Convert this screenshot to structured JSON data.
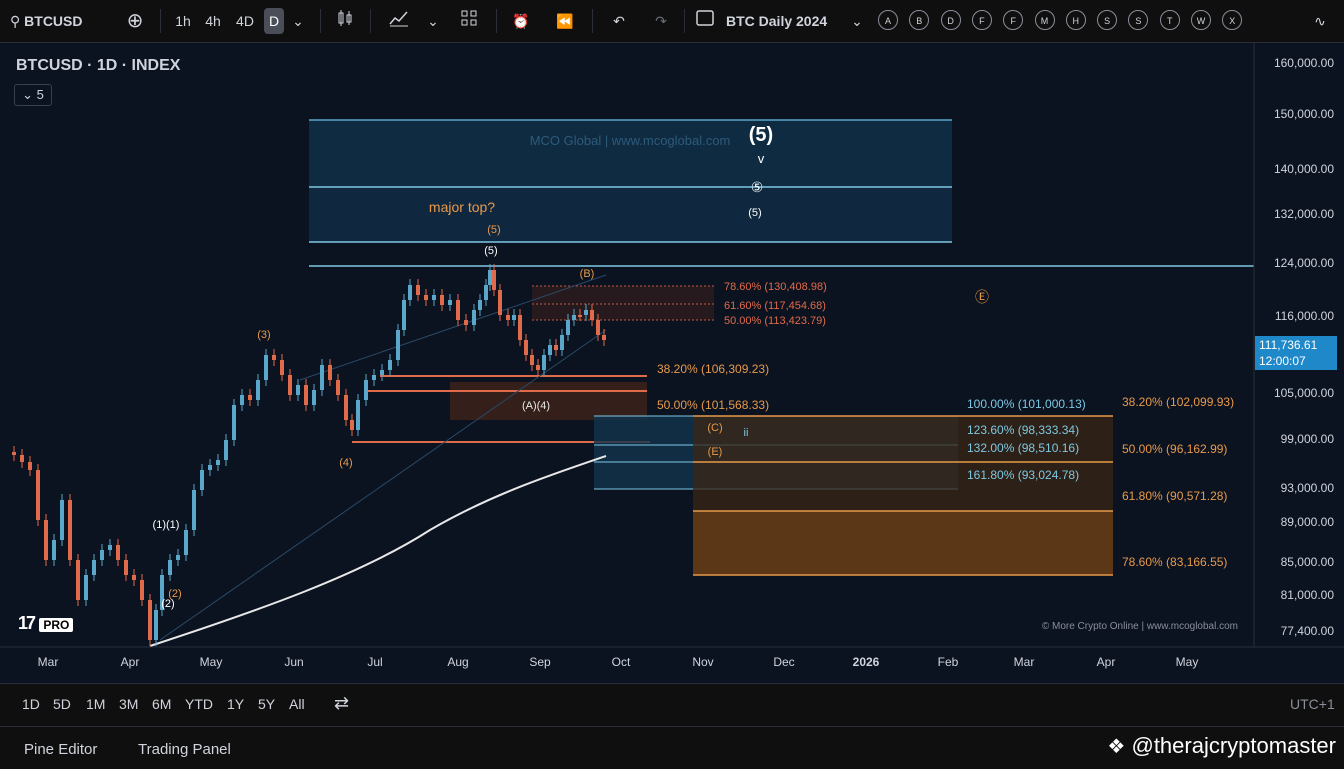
{
  "toolbar": {
    "symbol": "BTCUSD",
    "intervals": [
      "1h",
      "4h",
      "4D",
      "D"
    ],
    "active_interval": "D",
    "layout_name": "BTC Daily 2024",
    "alert_letters": [
      "A",
      "B",
      "D",
      "F",
      "F",
      "M",
      "H",
      "S",
      "S",
      "T",
      "W",
      "X"
    ]
  },
  "chart": {
    "legend_title": "BTCUSD · 1D · INDEX",
    "indicator_count": "5",
    "watermark": "MCO Global  |  www.mcoglobal.com",
    "copyright": "© More Crypto Online  |  www.mcoglobal.com",
    "logo_text": "PRO",
    "price_ticks": [
      "160,000.00",
      "150,000.00",
      "140,000.00",
      "132,000.00",
      "124,000.00",
      "116,000.00",
      "111,736.61",
      "105,000.00",
      "99,000.00",
      "93,000.00",
      "89,000.00",
      "85,000.00",
      "81,000.00",
      "77,400.00"
    ],
    "current_price": "111,736.61",
    "countdown": "12:00:07",
    "time_ticks": [
      "Mar",
      "Apr",
      "May",
      "Jun",
      "Jul",
      "Aug",
      "Sep",
      "Oct",
      "Nov",
      "Dec",
      "2026",
      "Feb",
      "Mar",
      "Apr",
      "May"
    ],
    "annotations": {
      "major_top": "major top?",
      "wave5_big": "(5)",
      "wave5_arrow": "v",
      "wave5_circle": "⑤",
      "wave5_small": "(5)",
      "wave5_orange": "(5)",
      "wave5_white": "(5)",
      "waveB": "(B)",
      "waveE": "Ⓔ",
      "wave3": "(3)",
      "wave4": "(4)",
      "waveA4": "(A)(4)",
      "waveC": "(C)",
      "waveE2": "(E)",
      "wave1": "(1)(1)",
      "wave2": "(2)",
      "wave2b": "(2)",
      "wave_ii": "ii"
    },
    "fib_upper": [
      "78.60% (130,408.98)",
      "61.60% (117,454.68)",
      "50.00% (113,423.79)"
    ],
    "fib_mid": [
      "38.20% (106,309.23)",
      "50.00% (101,568.33)"
    ],
    "fib_blue": [
      "100.00% (101,000.13)",
      "123.60% (98,333.34)",
      "132.00% (98,510.16)",
      "161.80% (93,024.78)"
    ],
    "fib_orange": [
      "38.20% (102,099.93)",
      "50.00% (96,162.99)",
      "61.80% (90,571.28)",
      "78.60% (83,166.55)"
    ],
    "timezone": "UTC+1"
  },
  "ranges": [
    "1D",
    "5D",
    "1M",
    "3M",
    "6M",
    "YTD",
    "1Y",
    "5Y",
    "All"
  ],
  "footer": {
    "tabs": [
      "Pine Editor",
      "Trading Panel"
    ],
    "handle": "@therajcryptomaster"
  },
  "colors": {
    "bg": "#0b1220",
    "up": "#5aa7c9",
    "down": "#e06b4a",
    "orange": "#e89a4a",
    "blue": "#7ec8e3"
  }
}
